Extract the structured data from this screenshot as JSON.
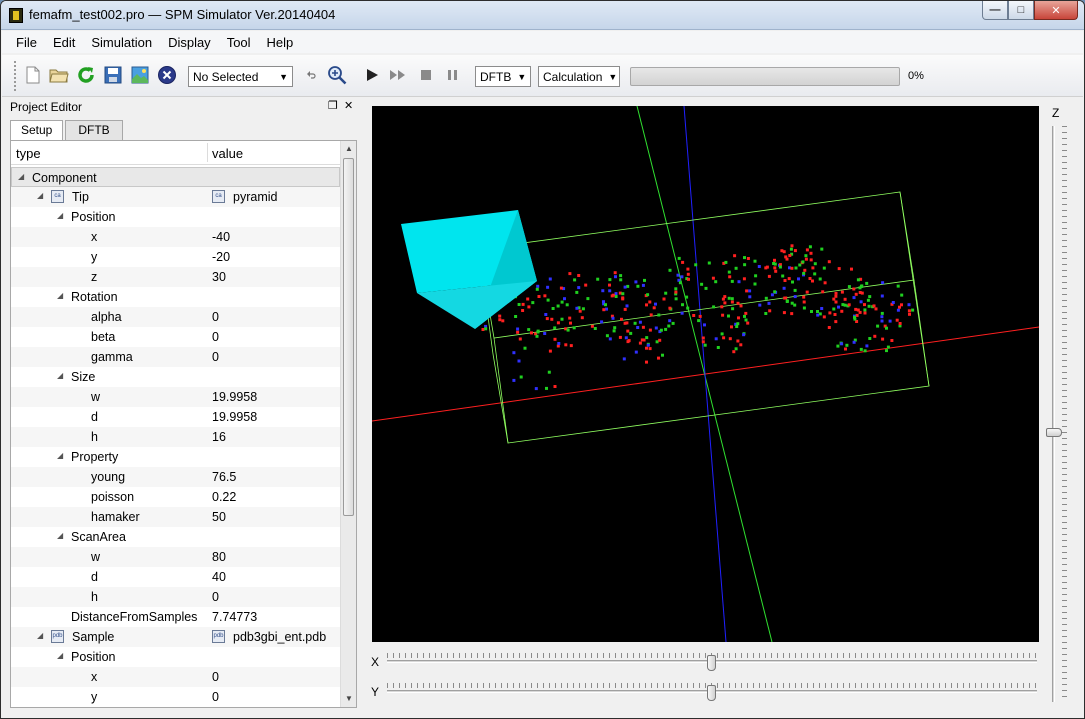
{
  "window": {
    "title": "femafm_test002.pro — SPM Simulator Ver.20140404",
    "controls": {
      "minimize": "—",
      "maximize": "□",
      "close": "✕"
    }
  },
  "menu": [
    "File",
    "Edit",
    "Simulation",
    "Display",
    "Tool",
    "Help"
  ],
  "toolbar": {
    "selection": "No Selected",
    "mode": "DFTB",
    "calc": "Calculation",
    "progress": 0,
    "progress_text": "0%"
  },
  "panel": {
    "title": "Project Editor",
    "float_icon": "❐",
    "close_icon": "✕",
    "tabs": [
      "Setup",
      "DFTB"
    ],
    "header": {
      "type": "type",
      "value": "value"
    },
    "rows": [
      {
        "level": 0,
        "exp": "◢",
        "name": "Component",
        "val": "",
        "sel": true
      },
      {
        "level": 1,
        "exp": "◢",
        "icon": "ca",
        "name": "Tip",
        "val": "pyramid",
        "vicon": "ca"
      },
      {
        "level": 2,
        "exp": "◢",
        "name": "Position",
        "val": ""
      },
      {
        "level": 3,
        "name": "x",
        "val": "-40"
      },
      {
        "level": 3,
        "name": "y",
        "val": "-20"
      },
      {
        "level": 3,
        "name": "z",
        "val": "30"
      },
      {
        "level": 2,
        "exp": "◢",
        "name": "Rotation",
        "val": ""
      },
      {
        "level": 3,
        "name": "alpha",
        "val": "0"
      },
      {
        "level": 3,
        "name": "beta",
        "val": "0"
      },
      {
        "level": 3,
        "name": "gamma",
        "val": "0"
      },
      {
        "level": 2,
        "exp": "◢",
        "name": "Size",
        "val": ""
      },
      {
        "level": 3,
        "name": "w",
        "val": "19.9958"
      },
      {
        "level": 3,
        "name": "d",
        "val": "19.9958"
      },
      {
        "level": 3,
        "name": "h",
        "val": "16"
      },
      {
        "level": 2,
        "exp": "◢",
        "name": "Property",
        "val": ""
      },
      {
        "level": 3,
        "name": "young",
        "val": "76.5"
      },
      {
        "level": 3,
        "name": "poisson",
        "val": "0.22"
      },
      {
        "level": 3,
        "name": "hamaker",
        "val": "50"
      },
      {
        "level": 2,
        "exp": "◢",
        "name": "ScanArea",
        "val": ""
      },
      {
        "level": 3,
        "name": "w",
        "val": "80"
      },
      {
        "level": 3,
        "name": "d",
        "val": "40"
      },
      {
        "level": 3,
        "name": "h",
        "val": "0"
      },
      {
        "level": 2,
        "name": "DistanceFromSamples",
        "val": "7.74773"
      },
      {
        "level": 1,
        "exp": "◢",
        "icon": "pdb",
        "name": "Sample",
        "val": "pdb3gbi_ent.pdb",
        "vicon": "pdb"
      },
      {
        "level": 2,
        "exp": "◢",
        "name": "Position",
        "val": ""
      },
      {
        "level": 3,
        "name": "x",
        "val": "0"
      },
      {
        "level": 3,
        "name": "y",
        "val": "0"
      }
    ]
  },
  "sliders": {
    "x_label": "X",
    "y_label": "Y",
    "z_label": "Z",
    "x_level": 0.5,
    "y_level": 0.5,
    "z_level": 0.5
  },
  "colors": {
    "tip": "#00e5ee",
    "atom_red": "#ff2020",
    "atom_green": "#20d020",
    "atom_blue": "#3030ff",
    "x_axis": "#ff2020",
    "y_axis": "#30e030",
    "z_axis": "#2020ff",
    "box": "#90ff60"
  }
}
